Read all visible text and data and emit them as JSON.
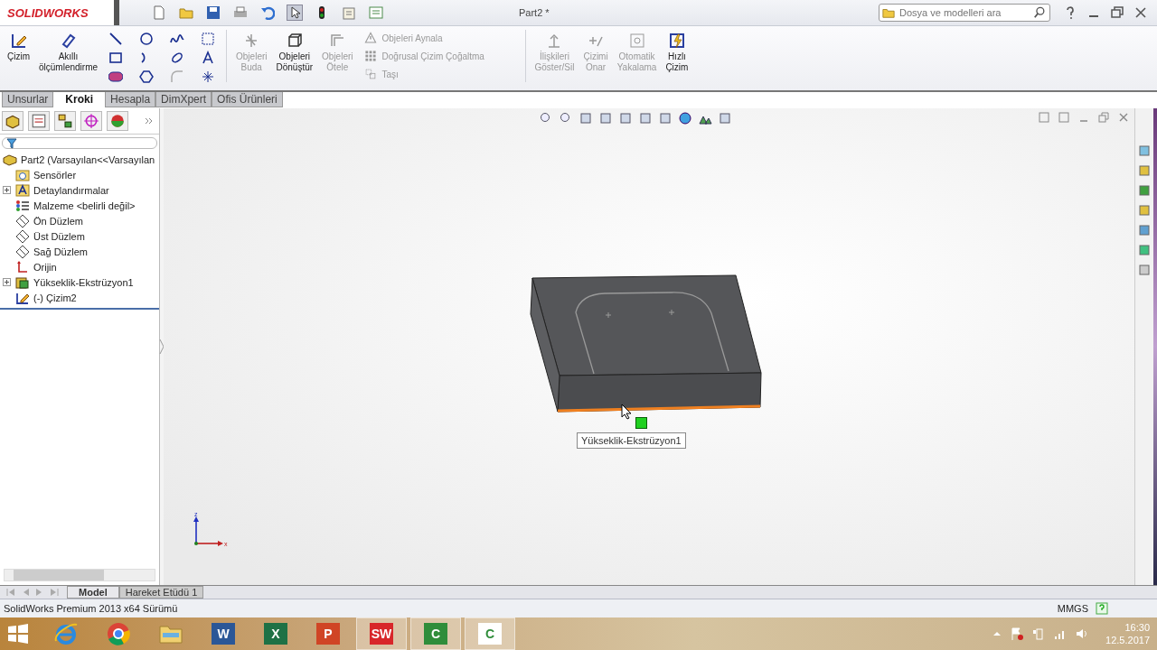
{
  "title_bar": {
    "logo": "SOLIDWORKS",
    "title": "Part2 *",
    "search": {
      "placeholder": "Dosya ve modelleri ara"
    }
  },
  "ribbon": {
    "left": [
      {
        "label": "Çizim",
        "disabled": false
      },
      {
        "label": "Akıllı ölçümlendirme",
        "disabled": false
      }
    ],
    "edit": [
      {
        "label": "Objeleri Buda",
        "disabled": true
      },
      {
        "label": "Objeleri Dönüştür",
        "disabled": false
      },
      {
        "label": "Objeleri Ötele",
        "disabled": true
      }
    ],
    "pattern": [
      {
        "label": "Objeleri Aynala",
        "disabled": true
      },
      {
        "label": "Doğrusal Çizim Çoğaltma",
        "disabled": true
      },
      {
        "label": "Taşı",
        "disabled": true
      }
    ],
    "right": [
      {
        "label": "İlişkileri Göster/Sil",
        "disabled": true
      },
      {
        "label": "Çizimi Onar",
        "disabled": true
      },
      {
        "label": "Otomatik Yakalama",
        "disabled": true
      },
      {
        "label": "Hızlı Çizim",
        "disabled": false
      }
    ]
  },
  "ribbon_tabs": [
    {
      "label": "Unsurlar",
      "selected": false
    },
    {
      "label": "Kroki",
      "selected": true
    },
    {
      "label": "Hesapla",
      "selected": false
    },
    {
      "label": "DimXpert",
      "selected": false
    },
    {
      "label": "Ofis Ürünleri",
      "selected": false
    }
  ],
  "feature_tree": {
    "root": "Part2  (Varsayılan<<Varsayılan",
    "items": [
      {
        "label": "Sensörler",
        "kind": "sensor",
        "expandable": false
      },
      {
        "label": "Detaylandırmalar",
        "kind": "annotation",
        "expandable": true
      },
      {
        "label": "Malzeme <belirli değil>",
        "kind": "material",
        "expandable": false
      },
      {
        "label": "Ön Düzlem",
        "kind": "plane",
        "expandable": false
      },
      {
        "label": "Üst Düzlem",
        "kind": "plane",
        "expandable": false
      },
      {
        "label": "Sağ Düzlem",
        "kind": "plane",
        "expandable": false
      },
      {
        "label": "Orijin",
        "kind": "origin",
        "expandable": false
      },
      {
        "label": "Yükseklik-Ekstrüzyon1",
        "kind": "feature",
        "expandable": true
      },
      {
        "label": "(-) Çizim2",
        "kind": "sketch",
        "expandable": false
      }
    ]
  },
  "viewport": {
    "tooltip": "Yükseklik-Ekstrüzyon1",
    "axis_labels": [
      "z",
      "x"
    ]
  },
  "bottom_tabs": [
    {
      "label": "Model",
      "selected": true
    },
    {
      "label": "Hareket Etüdü 1",
      "selected": false
    }
  ],
  "status_bar": {
    "text": "SolidWorks Premium 2013 x64 Sürümü",
    "units": "MMGS"
  },
  "taskbar": {
    "apps": [
      {
        "kind": "browser-e",
        "active": false
      },
      {
        "kind": "browser-c",
        "active": false
      },
      {
        "kind": "folder",
        "active": false
      },
      {
        "kind": "doc",
        "glyph": "W",
        "color": "#2b5797",
        "active": false
      },
      {
        "kind": "doc",
        "glyph": "X",
        "color": "#1e7145",
        "active": false
      },
      {
        "kind": "doc",
        "glyph": "P",
        "color": "#d04525",
        "active": false
      },
      {
        "kind": "doc",
        "glyph": "SW",
        "color": "#d8262a",
        "active": true
      },
      {
        "kind": "doc",
        "glyph": "C",
        "color": "#2f8d3a",
        "active": true
      },
      {
        "kind": "doc",
        "glyph": "C",
        "color": "#ffffff",
        "active": true
      }
    ],
    "time": "16:30",
    "date": "12.5.2017"
  }
}
